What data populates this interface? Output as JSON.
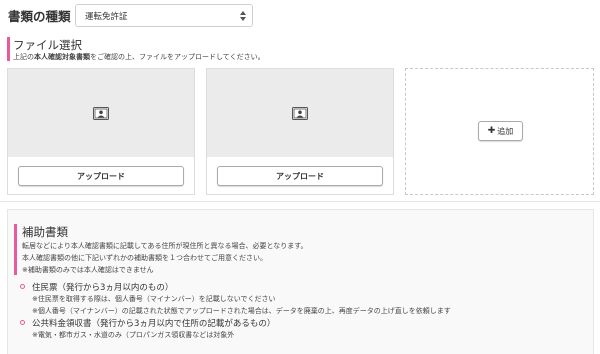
{
  "doc_type": {
    "label": "書類の種類",
    "selected": "運転免許証"
  },
  "file_select": {
    "title": "ファイル選択",
    "subtitle_prefix": "上記の",
    "subtitle_bold": "本人確認対象書類",
    "subtitle_suffix": "をご確認の上、ファイルをアップロードしてください。"
  },
  "upload_cards": [
    {
      "button_label": "アップロード",
      "icon": "id-card-icon"
    },
    {
      "button_label": "アップロード",
      "icon": "id-card-icon"
    }
  ],
  "add_card": {
    "button_label": "追加",
    "icon": "plus-icon"
  },
  "aux_docs": {
    "title": "補助書類",
    "lines": [
      "転居などにより本人確認書類に記載してある住所が現住所と異なる場合、必要となります。",
      "本人確認書類の他に下記いずれかの補助書類を１つ合わせてご用意ください。",
      "※補助書類のみでは本人確認はできません"
    ],
    "items": [
      {
        "title": "住民票（発行から3ヵ月以内のもの）",
        "notes": [
          "※住民票を取得する際は、個人番号（マイナンバー）を記載しないでください",
          "※個人番号（マイナンバー）の記載された状態でアップロードされた場合は、データを廃棄の上、再度データの上げ直しを依頼します"
        ]
      },
      {
        "title": "公共料金領収書（発行から3ヵ月以内で住所の記載があるもの）",
        "notes": [
          "※電気・都市ガス・水道のみ（プロパンガス領収書などは対象外"
        ]
      }
    ]
  },
  "colors": {
    "accent": "#e85a9a",
    "card_bg": "#ebebeb"
  }
}
